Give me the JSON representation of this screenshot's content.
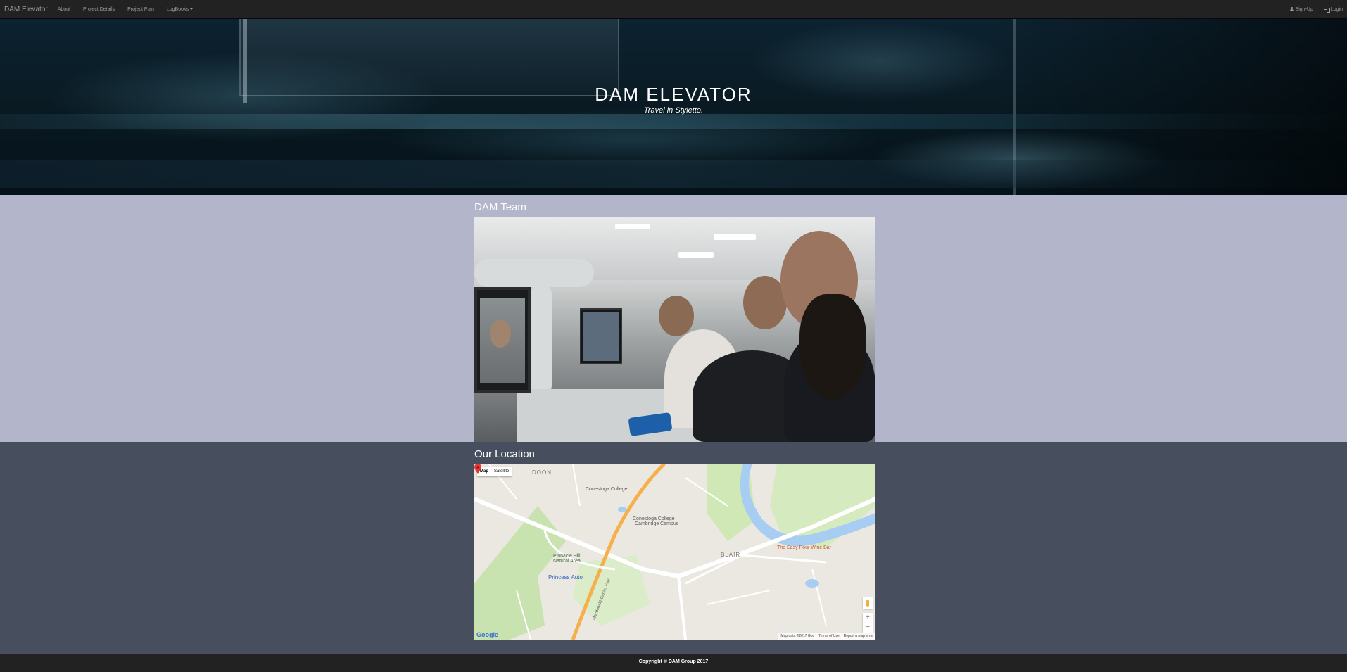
{
  "navbar": {
    "brand": "DAM Elevator",
    "links": [
      "About",
      "Project Details",
      "Project Plan",
      "LogBooks"
    ],
    "signup": "Sign-Up",
    "login": "Login"
  },
  "hero": {
    "title": "DAM ELEVATOR",
    "subtitle": "Travel in Styletto."
  },
  "team": {
    "title": "DAM Team"
  },
  "location": {
    "title": "Our Location",
    "map": {
      "toggle": [
        "Map",
        "Satellite"
      ],
      "labels": {
        "doon": "DOON",
        "conestoga_college": "Conestoga College",
        "conestoga_cambridge": "Conestoga College",
        "conestoga_cambridge_2": "Cambridge Campus",
        "easy_pour": "The Easy Pour Wine Bar",
        "blair": "BLAIR",
        "pinnacle": "Pinnacle Hill",
        "pinnacle_2": "Natural Area",
        "princess_auto": "Princess Auto",
        "hwy": "Macdonald-Cartier Fwy"
      },
      "google": "Google",
      "attribution": [
        "Map data ©2017 Goo",
        "Terms of Use",
        "Report a map error"
      ],
      "zoom_in": "+",
      "zoom_out": "−"
    }
  },
  "footer": {
    "copyright": "Copyright © DAM Group 2017"
  }
}
